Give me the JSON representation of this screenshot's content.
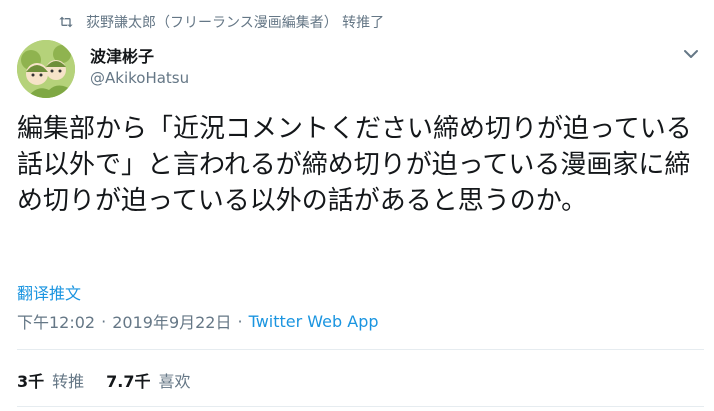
{
  "retweet": {
    "text": "荻野謙太郎（フリーランス漫画編集者） 转推了",
    "icon": "retweet-icon"
  },
  "author": {
    "name": "波津彬子",
    "handle": "@AkikoHatsu"
  },
  "tweet": {
    "text": "編集部から「近況コメントください締め切りが迫っている話以外で」と言われるが締め切りが迫っている漫画家に締め切りが迫っている以外の話があると思うのか。"
  },
  "translate_label": "翻译推文",
  "meta": {
    "time": "下午12:02",
    "separator1": "·",
    "date": "2019年9月22日",
    "separator2": "·",
    "source": "Twitter Web App"
  },
  "stats": {
    "retweets_count": "3千",
    "retweets_label": "转推",
    "likes_count": "7.7千",
    "likes_label": "喜欢"
  },
  "colors": {
    "link": "#1b95e0",
    "muted": "#657786",
    "text": "#14171a",
    "divider": "#e6ecf0"
  }
}
